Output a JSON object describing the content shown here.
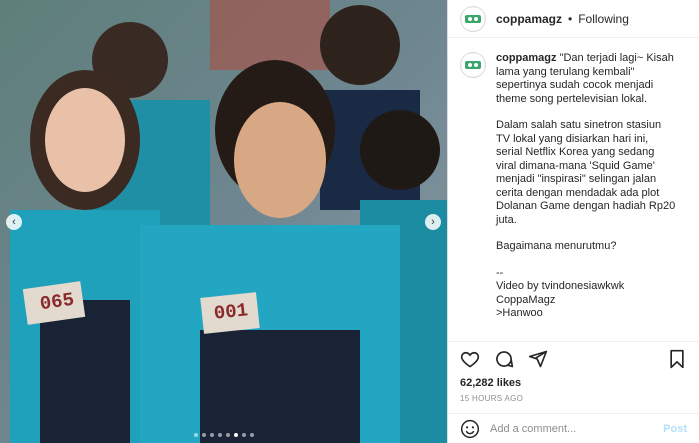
{
  "post": {
    "username": "coppamagz",
    "separator": "•",
    "follow_status": "Following"
  },
  "caption": {
    "username": "coppamagz",
    "lead": "\"Dan terjadi lagi~ Kisah lama yang terulang kembali\" sepertinya sudah cocok menjadi theme song pertelevisian lokal.",
    "para2": "Dalam salah satu sinetron stasiun TV lokal yang disiarkan hari ini, serial Netflix Korea yang sedang viral dimana-mana 'Squid Game' menjadi \"inspirasi\" selingan jalan cerita dengan mendadak ada plot Dolanan Game dengan hadiah Rp20 juta.",
    "para3": "Bagaimana menurutmu?",
    "credits": [
      "--",
      "Video by tvindonesiawkwk",
      "CoppaMagz",
      ">Hanwoo"
    ]
  },
  "media": {
    "badge_left": "065",
    "badge_center": "001",
    "carousel_count": 8,
    "carousel_active": 5
  },
  "stats": {
    "likes": "62,282 likes",
    "time_ago": "15 HOURS AGO"
  },
  "comment": {
    "placeholder": "Add a comment...",
    "post_label": "Post"
  },
  "icons": {
    "like": "heart-icon",
    "comment": "comment-icon",
    "share": "share-icon",
    "save": "bookmark-icon",
    "emoji": "emoji-icon",
    "prev": "chevron-left-icon",
    "next": "chevron-right-icon"
  }
}
